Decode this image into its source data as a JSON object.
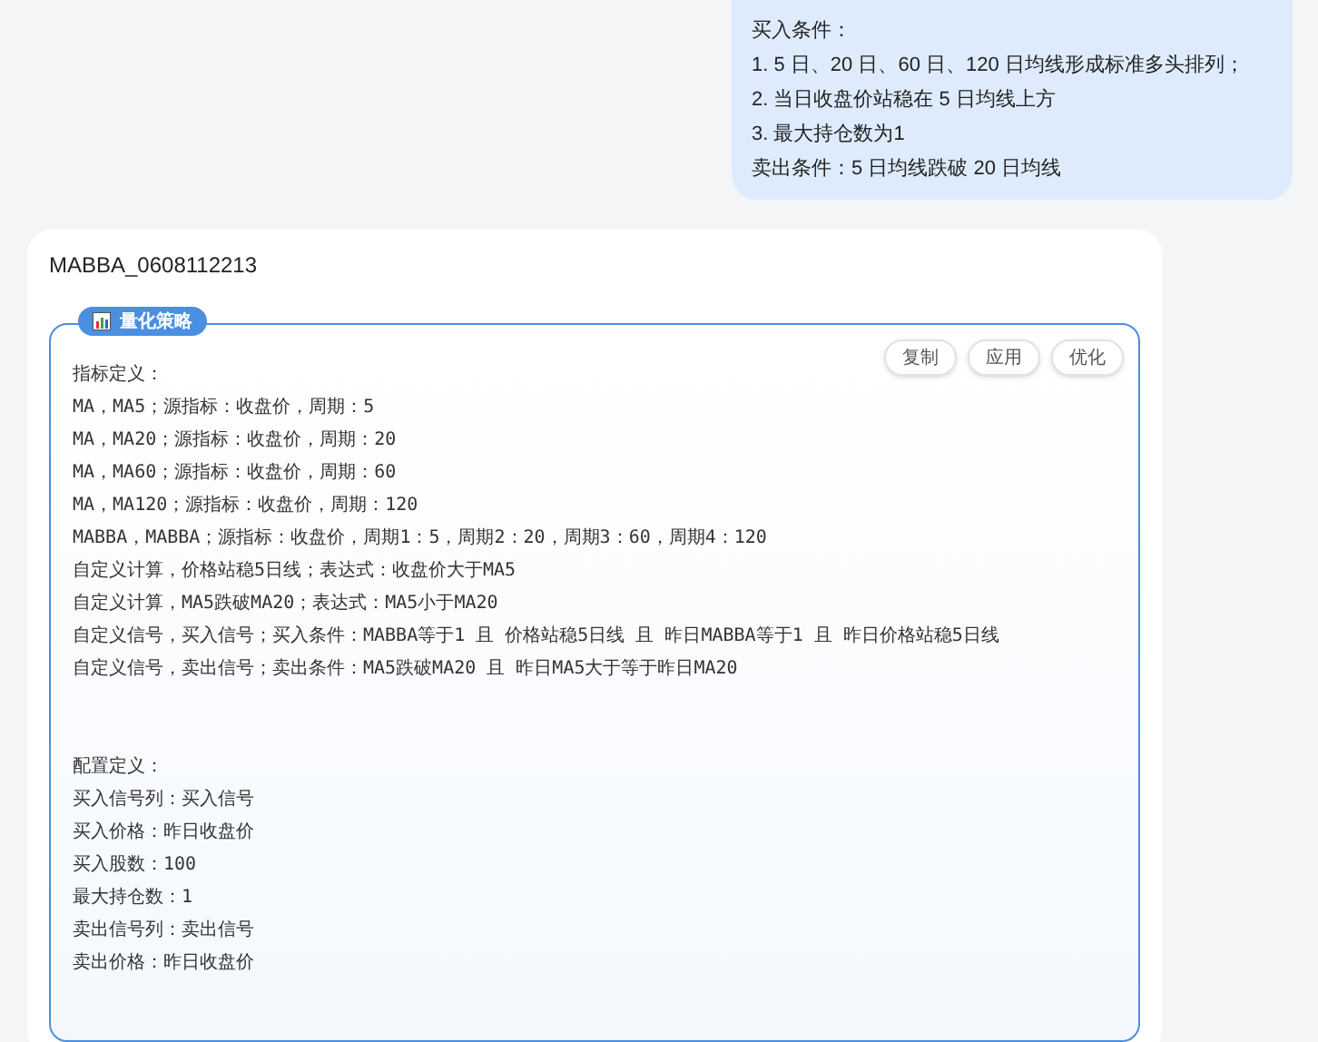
{
  "user_message": {
    "lines": [
      "买入条件：",
      "1. 5 日、20 日、60 日、120 日均线形成标准多头排列；",
      "2. 当日收盘价站稳在 5 日均线上方",
      "3. 最大持仓数为1",
      "卖出条件：5 日均线跌破 20 日均线"
    ]
  },
  "reply_card": {
    "title": "MABBA_0608112213",
    "strategy": {
      "badge": "量化策略",
      "buttons": [
        "复制",
        "应用",
        "优化"
      ],
      "sections": [
        {
          "lines": [
            "指标定义：",
            "MA，MA5；源指标：收盘价，周期：5",
            "MA，MA20；源指标：收盘价，周期：20",
            "MA，MA60；源指标：收盘价，周期：60",
            "MA，MA120；源指标：收盘价，周期：120",
            "MABBA，MABBA；源指标：收盘价，周期1：5，周期2：20，周期3：60，周期4：120",
            "自定义计算，价格站稳5日线；表达式：收盘价大于MA5",
            "自定义计算，MA5跌破MA20；表达式：MA5小于MA20",
            "自定义信号，买入信号；买入条件：MABBA等于1 且 价格站稳5日线 且 昨日MABBA等于1 且 昨日价格站稳5日线",
            "自定义信号，卖出信号；卖出条件：MA5跌破MA20 且 昨日MA5大于等于昨日MA20"
          ]
        },
        {
          "lines": [
            "配置定义：",
            "买入信号列：买入信号",
            "买入价格：昨日收盘价",
            "买入股数：100",
            "最大持仓数：1",
            "卖出信号列：卖出信号",
            "卖出价格：昨日收盘价"
          ]
        }
      ]
    }
  }
}
